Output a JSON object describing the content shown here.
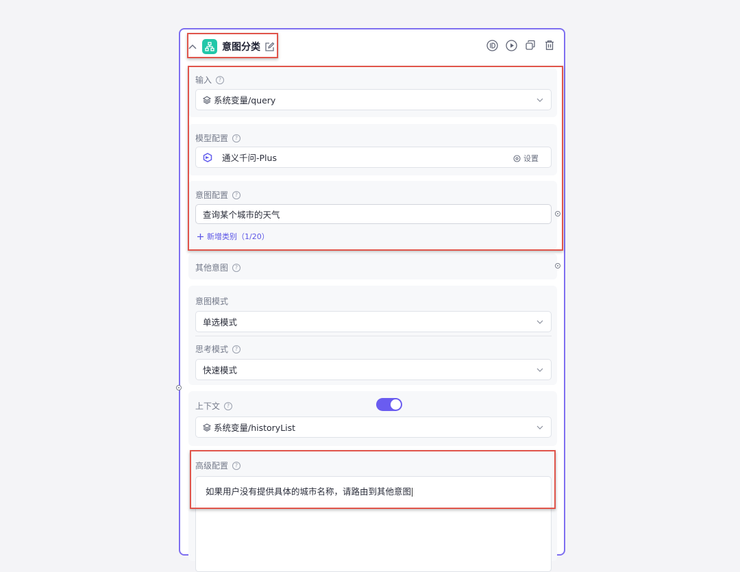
{
  "node": {
    "title": "意图分类",
    "colors": {
      "accent": "#7d6ef0",
      "icon_bg": "#22c7a9",
      "highlight": "#e0544a"
    }
  },
  "input": {
    "label": "输入",
    "value": "系统变量/query"
  },
  "model": {
    "label": "模型配置",
    "name": "通义千问-Plus",
    "settings_label": "设置"
  },
  "intent": {
    "label": "意图配置",
    "item_value": "查询某个城市的天气",
    "add_label": "新增类别（1/20）"
  },
  "other_intent": {
    "label": "其他意图"
  },
  "intent_mode": {
    "label": "意图模式",
    "value": "单选模式"
  },
  "think_mode": {
    "label": "思考模式",
    "value": "快速模式"
  },
  "context": {
    "label": "上下文",
    "enabled": true,
    "value": "系统变量/historyList"
  },
  "advanced": {
    "label": "高级配置",
    "value": "如果用户没有提供具体的城市名称，请路由到其他意图"
  }
}
